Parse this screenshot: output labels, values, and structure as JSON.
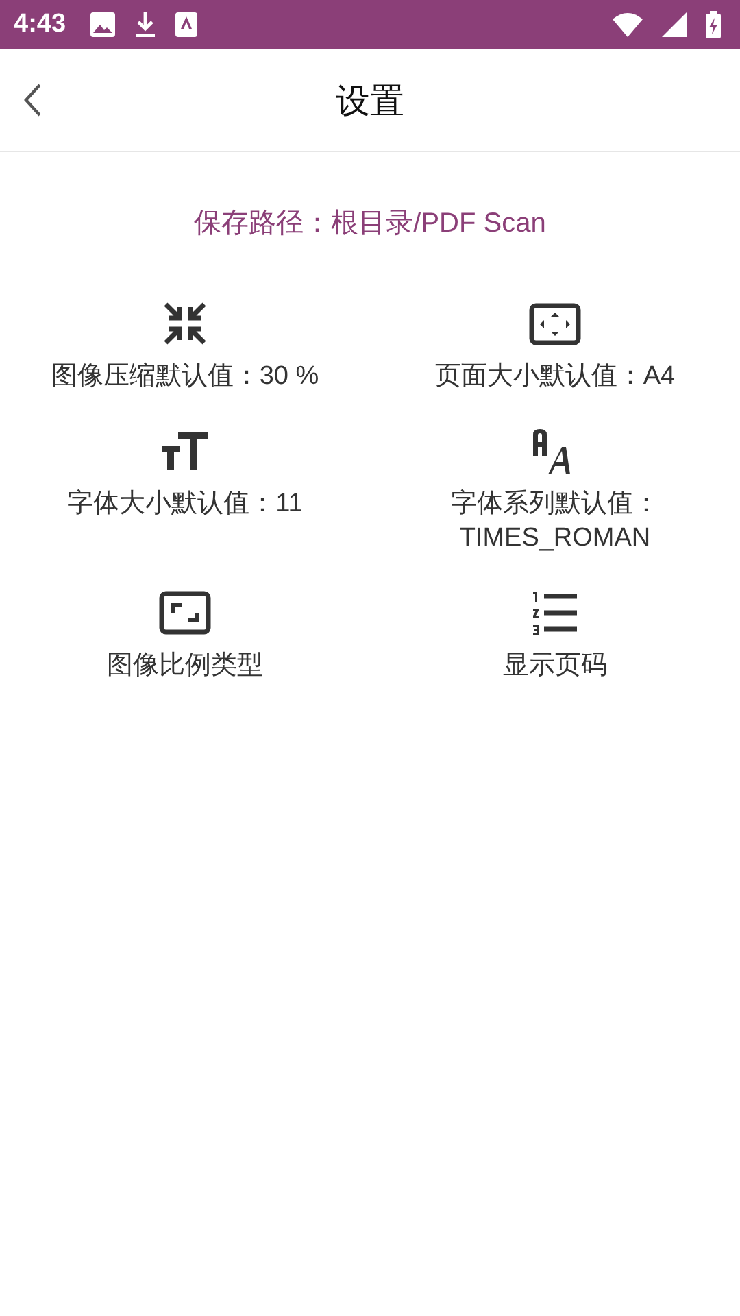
{
  "status_bar": {
    "time": "4:43"
  },
  "header": {
    "title": "设置"
  },
  "save_path": "保存路径：根目录/PDF Scan",
  "settings": [
    {
      "kind": "compress",
      "label": "图像压缩默认值：30 %"
    },
    {
      "kind": "page-size",
      "label": "页面大小默认值：A4"
    },
    {
      "kind": "text-size",
      "label": "字体大小默认值：11"
    },
    {
      "kind": "font-family",
      "label": "字体系列默认值：TIMES_ROMAN"
    },
    {
      "kind": "aspect",
      "label": "图像比例类型"
    },
    {
      "kind": "page-numbers",
      "label": "显示页码"
    }
  ]
}
